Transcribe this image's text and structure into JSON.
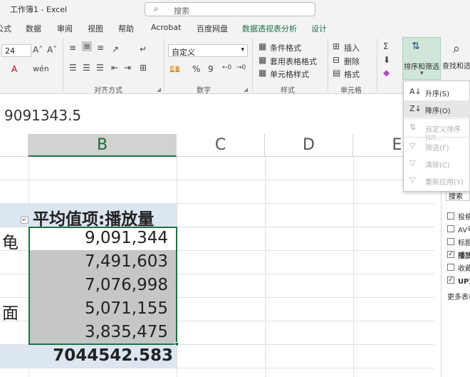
{
  "app": {
    "window_title": "工作簿1  -  Excel",
    "search_placeholder": "搜索"
  },
  "tabs": [
    "公式",
    "数据",
    "审阅",
    "视图",
    "帮助",
    "Acrobat",
    "百度网盘",
    "数据透视表分析",
    "设计"
  ],
  "ribbon": {
    "font_size": "24",
    "number_format": "自定义",
    "percent_symbol": "%",
    "comma_symbol": "9",
    "styles": {
      "conditional": "条件格式",
      "table_format": "套用表格格式",
      "cell_styles": "单元格样式"
    },
    "cells": {
      "insert": "插入",
      "delete": "删除",
      "format": "格式"
    },
    "editing": {
      "sort_filter": "排序和筛选",
      "find_select": "查找和选"
    },
    "groups": {
      "alignment": "对齐方式",
      "number": "数字",
      "styles": "样式",
      "cells": "单元格"
    }
  },
  "sort_menu": [
    {
      "label": "升序(S)",
      "enabled": true,
      "icon": "sort-ascending-icon"
    },
    {
      "label": "降序(O)",
      "enabled": true,
      "icon": "sort-descending-icon"
    },
    {
      "label": "自定义排序(U)...",
      "enabled": false,
      "icon": "custom-sort-icon"
    },
    {
      "label": "筛选(F)",
      "enabled": false,
      "icon": "filter-icon"
    },
    {
      "label": "清除(C)",
      "enabled": false,
      "icon": "clear-filter-icon"
    },
    {
      "label": "重新应用(Y)",
      "enabled": false,
      "icon": "reapply-icon"
    }
  ],
  "formula_bar": {
    "value": "9091343.5"
  },
  "columns": [
    "B",
    "C",
    "D",
    "E"
  ],
  "pivot": {
    "header": "平均值项:播放量",
    "row_labels": [
      "龟",
      "面"
    ],
    "values": [
      "9,091,344",
      "7,491,603",
      "7,076,998",
      "5,071,155",
      "3,835,475"
    ],
    "grand_total": "7044542.583"
  },
  "field_panel": {
    "search_label": "搜索",
    "fields": [
      {
        "label": "投稿",
        "checked": false
      },
      {
        "label": "AV号",
        "checked": false
      },
      {
        "label": "标题",
        "checked": false
      },
      {
        "label": "播放",
        "checked": true
      },
      {
        "label": "收藏",
        "checked": false
      },
      {
        "label": "UP主",
        "checked": true
      }
    ],
    "more_label": "更多表格"
  },
  "colors": {
    "accent": "#1e7145",
    "pivot_header": "#dce6f1",
    "selection": "#c6c6c6"
  }
}
